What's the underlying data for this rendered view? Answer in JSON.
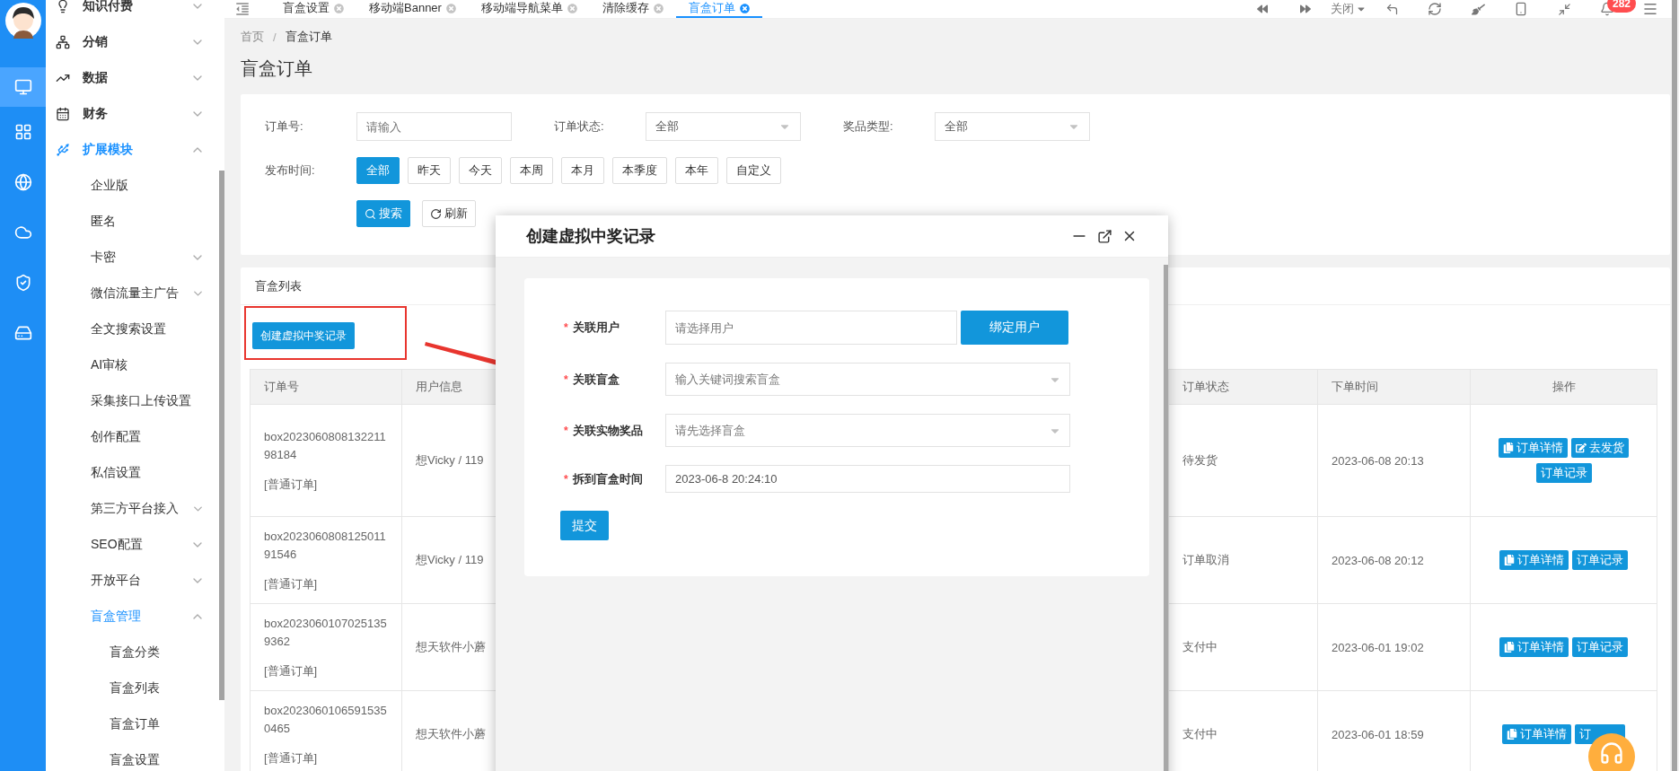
{
  "rail": [
    {
      "selected": true
    },
    {
      "selected": false
    },
    {
      "selected": false
    },
    {
      "selected": false
    },
    {
      "selected": false
    },
    {
      "selected": false
    }
  ],
  "sidebar": {
    "items": [
      {
        "label": "知识付费",
        "expanded": false,
        "active": false
      },
      {
        "label": "分销",
        "expanded": false,
        "active": false
      },
      {
        "label": "数据",
        "expanded": false,
        "active": false
      },
      {
        "label": "财务",
        "expanded": false,
        "active": false
      },
      {
        "label": "扩展模块",
        "expanded": true,
        "active": true,
        "children": [
          {
            "label": "企业版",
            "active": false
          },
          {
            "label": "匿名",
            "active": false
          },
          {
            "label": "卡密",
            "expanded": false,
            "active": false
          },
          {
            "label": "微信流量主广告",
            "expanded": false,
            "active": false
          },
          {
            "label": "全文搜索设置",
            "active": false
          },
          {
            "label": "AI审核",
            "active": false
          },
          {
            "label": "采集接口上传设置",
            "active": false
          },
          {
            "label": "创作配置",
            "active": false
          },
          {
            "label": "私信设置",
            "active": false
          },
          {
            "label": "第三方平台接入",
            "expanded": false,
            "active": false
          },
          {
            "label": "SEO配置",
            "expanded": false,
            "active": false
          },
          {
            "label": "开放平台",
            "expanded": false,
            "active": false
          },
          {
            "label": "盲盒管理",
            "expanded": true,
            "active": true,
            "children": [
              {
                "label": "盲盒分类",
                "active": false
              },
              {
                "label": "盲盒列表",
                "active": false
              },
              {
                "label": "盲盒订单",
                "active": false
              },
              {
                "label": "盲盒设置",
                "active": false
              }
            ]
          }
        ]
      }
    ]
  },
  "tabs": [
    {
      "label": "盲盒设置",
      "selected": false
    },
    {
      "label": "移动端Banner",
      "selected": false
    },
    {
      "label": "移动端导航菜单",
      "selected": false
    },
    {
      "label": "清除缓存",
      "selected": false
    },
    {
      "label": "盲盒订单",
      "selected": true
    }
  ],
  "toolbar": {
    "close_menu": "关闭",
    "notification_count": "282"
  },
  "breadcrumb": {
    "items": [
      "首页",
      "盲盒订单"
    ],
    "separator": "/"
  },
  "page_title": "盲盒订单",
  "filters": {
    "fields": [
      {
        "label": "订单号:",
        "kind": "input",
        "placeholder": "请输入"
      },
      {
        "label": "订单状态:",
        "kind": "select",
        "value": "全部"
      },
      {
        "label": "奖品类型:",
        "kind": "select",
        "value": "全部"
      }
    ],
    "time": {
      "label": "发布时间:",
      "options": [
        {
          "label": "全部",
          "selected": true
        },
        {
          "label": "昨天",
          "selected": false
        },
        {
          "label": "今天",
          "selected": false
        },
        {
          "label": "本周",
          "selected": false
        },
        {
          "label": "本月",
          "selected": false
        },
        {
          "label": "本季度",
          "selected": false
        },
        {
          "label": "本年",
          "selected": false
        },
        {
          "label": "自定义",
          "selected": false
        }
      ]
    },
    "search_button": "搜索",
    "refresh_button": "刷新"
  },
  "list": {
    "title": "盲盒列表",
    "create_button": "创建虚拟中奖记录",
    "columns": [
      "订单号",
      "用户信息",
      "订单状态",
      "下单时间",
      "操作"
    ],
    "rows": [
      {
        "order_id": "box202306080813221198184",
        "order_type": "[普通订单]",
        "user": "想Vicky / 119",
        "status": "待发货",
        "time": "2023-06-08 20:13",
        "actions": [
          {
            "label": "订单详情",
            "kind": "detail"
          },
          {
            "label": "去发货",
            "kind": "ship"
          },
          {
            "label": "订单记录",
            "kind": "log"
          }
        ]
      },
      {
        "order_id": "box202306080812501191546",
        "order_type": "[普通订单]",
        "user": "想Vicky / 119",
        "status": "订单取消",
        "time": "2023-06-08 20:12",
        "actions": [
          {
            "label": "订单详情",
            "kind": "detail"
          },
          {
            "label": "订单记录",
            "kind": "log"
          }
        ]
      },
      {
        "order_id": "box20230601070251359362",
        "order_type": "[普通订单]",
        "user": "想天软件小蘑",
        "status": "支付中",
        "time": "2023-06-01 19:02",
        "actions": [
          {
            "label": "订单详情",
            "kind": "detail"
          },
          {
            "label": "订单记录",
            "kind": "log"
          }
        ]
      },
      {
        "order_id": "box20230601065915350465",
        "order_type": "[普通订单]",
        "user": "想天软件小蘑",
        "status": "支付中",
        "time": "2023-06-01 18:59",
        "actions": [
          {
            "label": "订单详情",
            "kind": "detail"
          },
          {
            "label": "订",
            "kind": "log"
          }
        ]
      }
    ]
  },
  "modal": {
    "title": "创建虚拟中奖记录",
    "fields": [
      {
        "label": "关联用户",
        "required": true,
        "kind": "input",
        "placeholder": "请选择用户"
      },
      {
        "label": "关联盲盒",
        "required": true,
        "kind": "select",
        "placeholder": "输入关键词搜索盲盒"
      },
      {
        "label": "关联实物奖品",
        "required": true,
        "kind": "select",
        "placeholder": "请先选择盲盒"
      },
      {
        "label": "拆到盲盒时间",
        "required": true,
        "kind": "input",
        "value": "2023-06-8 20:24:10"
      }
    ],
    "required_mark": "*",
    "bind_button": "绑定用户",
    "submit_button": "提交"
  }
}
